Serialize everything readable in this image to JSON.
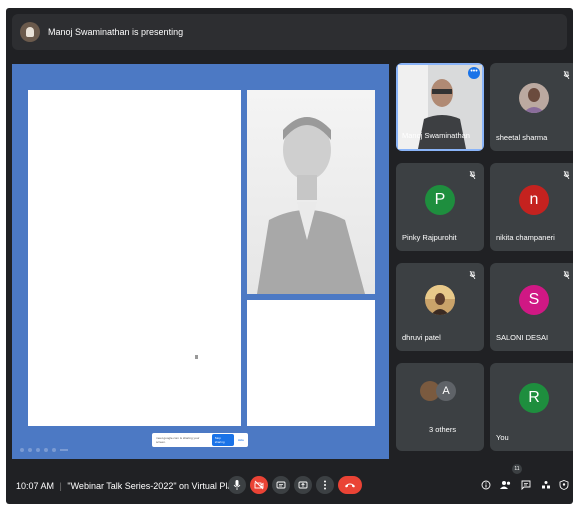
{
  "header": {
    "presenting_text": "Manoj Swaminathan is presenting"
  },
  "share_bar": {
    "text": "meet.google.com is sharing your screen.",
    "stop_label": "Stop sharing",
    "hide_label": "Hide"
  },
  "participants": [
    {
      "name": "Manoj Swaminathan",
      "type": "video",
      "pinned": true
    },
    {
      "name": "sheetal sharma",
      "type": "photo",
      "muted": true
    },
    {
      "name": "Pinky Rajpurohit",
      "initial": "P",
      "color": "#1e8e3e",
      "muted": true
    },
    {
      "name": "nikita champaneri",
      "initial": "n",
      "color": "#c5221f",
      "muted": true
    },
    {
      "name": "dhruvi patel",
      "type": "photo",
      "muted": true
    },
    {
      "name": "SALONI DESAI",
      "initial": "S",
      "color": "#d01884",
      "muted": true
    },
    {
      "name": "3 others",
      "type": "group",
      "initial": "A"
    },
    {
      "name": "You",
      "initial": "R",
      "color": "#1e8e3e"
    }
  ],
  "bottom": {
    "time": "10:07 AM",
    "separator": "|",
    "meeting_title": "\"Webinar Talk Series-2022\" on Virtual Plat...",
    "people_count": "11"
  },
  "colors": {
    "accent": "#4c79c4",
    "end_call": "#ea4335",
    "tile_bg": "#3c4043",
    "bg": "#202124"
  }
}
